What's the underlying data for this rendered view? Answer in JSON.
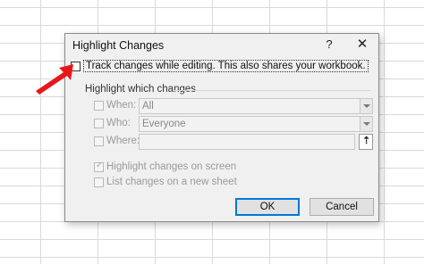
{
  "dialog": {
    "title": "Highlight Changes",
    "help_glyph": "?",
    "close_glyph": "✕",
    "track_changes": {
      "label": "Track changes while editing. This also shares your workbook.",
      "checked": false
    },
    "group_title": "Highlight which changes",
    "when": {
      "label": "When:",
      "value": "All",
      "checked": false
    },
    "who": {
      "label": "Who:",
      "value": "Everyone",
      "checked": false
    },
    "where": {
      "label": "Where:",
      "value": "",
      "checked": false
    },
    "highlight_on_screen": {
      "label": "Highlight changes on screen",
      "checked": true
    },
    "list_on_new_sheet": {
      "label": "List changes on a new sheet",
      "checked": false
    },
    "ok_label": "OK",
    "cancel_label": "Cancel"
  },
  "colors": {
    "annotation_arrow": "#e8161b",
    "ok_border": "#0078d7",
    "dialog_bg": "#f0f0f0"
  }
}
